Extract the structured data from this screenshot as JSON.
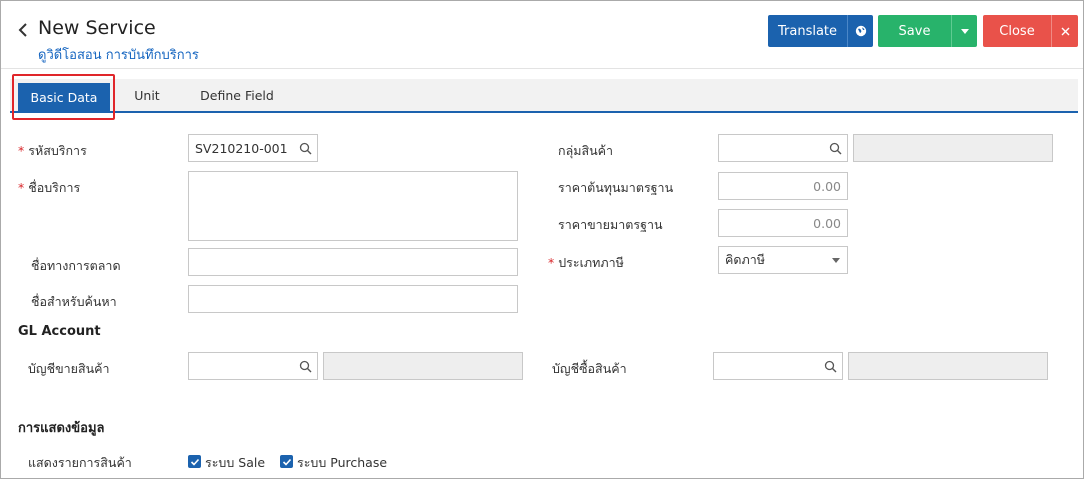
{
  "header": {
    "title": "New Service",
    "subtitle": "ดูวิดีโอสอน การบันทึกบริการ",
    "buttons": {
      "translate": "Translate",
      "save": "Save",
      "close": "Close"
    }
  },
  "tabs": [
    {
      "label": "Basic Data",
      "active": true
    },
    {
      "label": "Unit",
      "active": false
    },
    {
      "label": "Define Field",
      "active": false
    }
  ],
  "form": {
    "service_code": {
      "label": "รหัสบริการ",
      "value": "SV210210-001",
      "required": true
    },
    "service_name": {
      "label": "ชื่อบริการ",
      "value": "",
      "required": true
    },
    "marketing_name": {
      "label": "ชื่อทางการตลาด",
      "value": ""
    },
    "search_name": {
      "label": "ชื่อสำหรับค้นหา",
      "value": ""
    },
    "product_group": {
      "label": "กลุ่มสินค้า",
      "value": ""
    },
    "standard_cost": {
      "label": "ราคาต้นทุนมาตรฐาน",
      "value": "0.00"
    },
    "standard_price": {
      "label": "ราคาขายมาตรฐาน",
      "value": "0.00"
    },
    "tax_type": {
      "label": "ประเภทภาษี",
      "value": "คิดภาษี",
      "required": true
    }
  },
  "gl_account": {
    "heading": "GL Account",
    "sales_account": {
      "label": "บัญชีขายสินค้า",
      "value": ""
    },
    "purchase_account": {
      "label": "บัญชีซื้อสินค้า",
      "value": ""
    }
  },
  "display": {
    "heading": "การแสดงข้อมูล",
    "show_items_label": "แสดงรายการสินค้า",
    "options": [
      {
        "label": "ระบบ Sale",
        "checked": true
      },
      {
        "label": "ระบบ Purchase",
        "checked": true
      }
    ]
  },
  "colors": {
    "primary": "#1b62ae",
    "success": "#28b36b",
    "danger": "#e9524a",
    "required": "#d9262a"
  }
}
